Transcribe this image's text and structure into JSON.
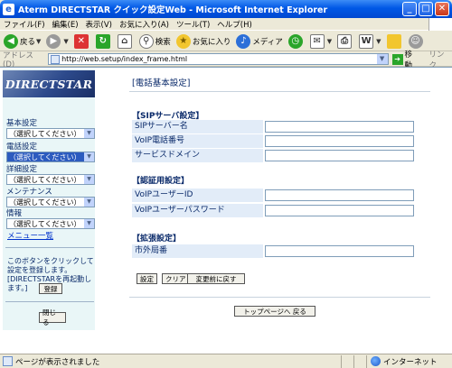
{
  "window": {
    "title": "Aterm DIRECTSTAR クイック設定Web - Microsoft Internet Explorer",
    "minimize": "_",
    "maximize": "□",
    "close": "✕"
  },
  "menu": [
    "ファイル(F)",
    "編集(E)",
    "表示(V)",
    "お気に入り(A)",
    "ツール(T)",
    "ヘルプ(H)"
  ],
  "toolbar": {
    "back": "戻る",
    "search": "検索",
    "favorites": "お気に入り",
    "media": "メディア"
  },
  "address": {
    "label": "アドレス(D)",
    "url": "http://web.setup/index_frame.html",
    "go": "移動",
    "links": "リンク"
  },
  "sidebar": {
    "logo": "DIRECTSTAR",
    "categories": [
      {
        "label": "基本設定",
        "selected": "（選択してください）"
      },
      {
        "label": "電話設定",
        "selected": "（選択してください）"
      },
      {
        "label": "詳細設定",
        "selected": "（選択してください）"
      },
      {
        "label": "メンテナンス",
        "selected": "（選択してください）"
      },
      {
        "label": "情報",
        "selected": "（選択してください）"
      }
    ],
    "menu_link": "メニュー一覧",
    "note": "このボタンをクリックして設定を登録します。[DIRECTSTARを再起動します。]",
    "register": "登録",
    "close": "閉じる"
  },
  "main": {
    "title": "[電話基本設定]",
    "sections": [
      {
        "title": "【SIPサーバ設定】",
        "fields": [
          "SIPサーバー名",
          "VoIP電話番号",
          "サービスドメイン"
        ]
      },
      {
        "title": "【認証用設定】",
        "fields": [
          "VoIPユーザーID",
          "VoIPユーザーパスワード"
        ]
      },
      {
        "title": "【拡張設定】",
        "fields": [
          "市外局番"
        ]
      }
    ],
    "buttons": {
      "set": "設定",
      "clear": "クリア",
      "revert": "変更前に戻す"
    },
    "top_page": "トップページへ 戻る"
  },
  "status": {
    "text": "ページが表示されました",
    "zone": "インターネット"
  }
}
